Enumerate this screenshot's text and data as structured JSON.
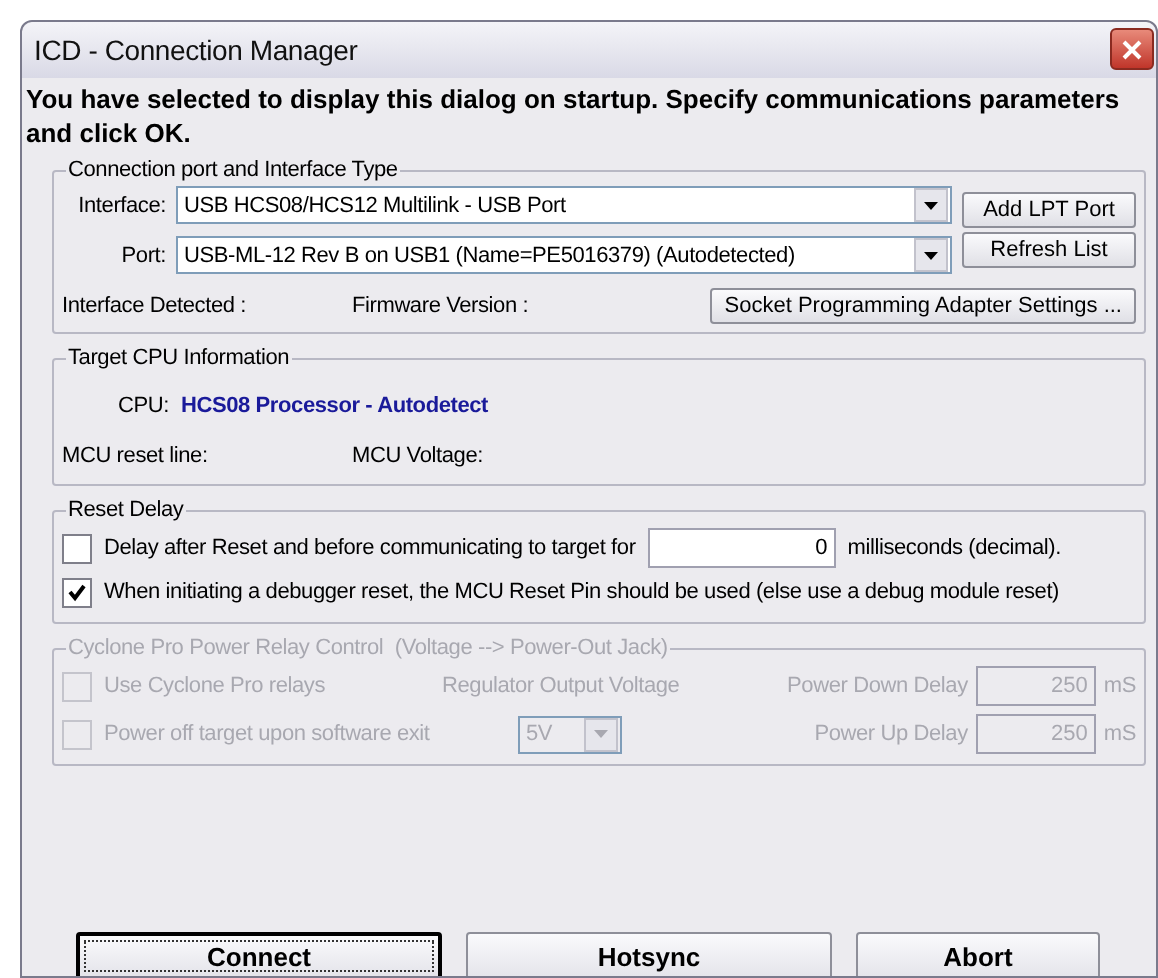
{
  "window": {
    "title": "ICD - Connection Manager"
  },
  "intro": "You have selected to display this dialog on startup. Specify communications parameters and click OK.",
  "connection_group": {
    "legend": "Connection port and Interface Type",
    "interface": {
      "label": "Interface:",
      "value": "USB HCS08/HCS12 Multilink - USB Port"
    },
    "port": {
      "label": "Port:",
      "value": "USB-ML-12 Rev B on USB1 (Name=PE5016379) (Autodetected)"
    },
    "side_buttons": [
      "Add LPT Port",
      "Refresh List"
    ],
    "interface_detected": "Interface Detected :",
    "firmware_version": "Firmware Version :",
    "adapter_button": "Socket Programming Adapter Settings ..."
  },
  "cpu_group": {
    "legend": "Target CPU Information",
    "cpu_label": "CPU:",
    "cpu_value": "HCS08 Processor - Autodetect",
    "reset_line": "MCU reset line:",
    "voltage": "MCU Voltage:"
  },
  "reset_group": {
    "legend": "Reset Delay",
    "options": [
      {
        "label": "Delay after Reset and before communicating to target for",
        "checked": false,
        "value": "0",
        "suffix": "milliseconds (decimal)."
      },
      {
        "label": "When initiating a debugger reset, the MCU Reset Pin should be used (else use a debug module reset)",
        "checked": true
      }
    ]
  },
  "power_group": {
    "legend": "Cyclone Pro Power Relay Control  (Voltage --> Power-Out Jack)",
    "disabled": true,
    "options": [
      {
        "label": "Use Cyclone Pro relays",
        "checked": false
      },
      {
        "label": "Power off target upon software exit",
        "checked": false
      }
    ],
    "voltage_label": "Regulator Output Voltage",
    "voltage_value": "5V",
    "delays": [
      {
        "label": "Power Down Delay",
        "value": "250",
        "unit": "mS"
      },
      {
        "label": "Power Up Delay",
        "value": "250",
        "unit": "mS"
      }
    ]
  },
  "buttons": [
    {
      "label": "Connect",
      "default": true
    },
    {
      "label": "Hotsync",
      "default": false
    },
    {
      "label": "Abort",
      "default": false
    }
  ]
}
